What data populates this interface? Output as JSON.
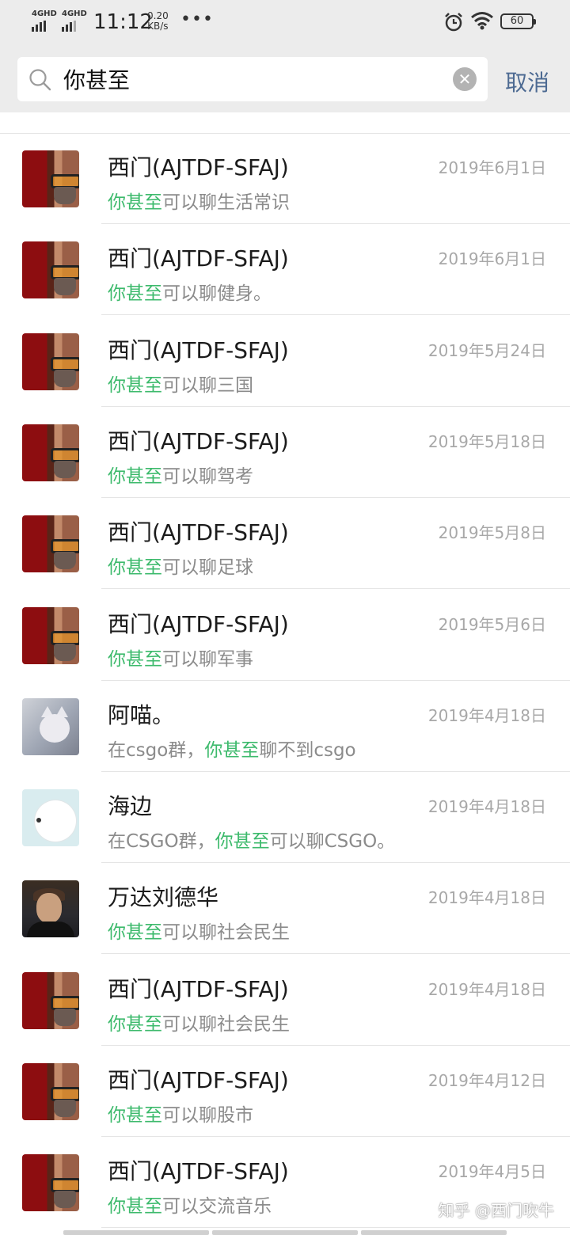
{
  "status_bar": {
    "signal1": "4GHD",
    "signal2": "4GHD",
    "time": "11:12",
    "speed_value": "0.20",
    "speed_unit": "KB/s",
    "more": "•••",
    "battery": "60"
  },
  "search": {
    "query": "你甚至",
    "cancel_label": "取消",
    "clear_icon": "clear-icon",
    "search_icon": "search-icon"
  },
  "highlight_color": "#3dba6c",
  "results": [
    {
      "name": "西门(AJTDF-SFAJ)",
      "date": "2019年6月1日",
      "pre": "",
      "hit": "你甚至",
      "post": "可以聊生活常识",
      "avatar": "ximen"
    },
    {
      "name": "西门(AJTDF-SFAJ)",
      "date": "2019年6月1日",
      "pre": "",
      "hit": "你甚至",
      "post": "可以聊健身。",
      "avatar": "ximen"
    },
    {
      "name": "西门(AJTDF-SFAJ)",
      "date": "2019年5月24日",
      "pre": "",
      "hit": "你甚至",
      "post": "可以聊三国",
      "avatar": "ximen"
    },
    {
      "name": "西门(AJTDF-SFAJ)",
      "date": "2019年5月18日",
      "pre": "",
      "hit": "你甚至",
      "post": "可以聊驾考",
      "avatar": "ximen"
    },
    {
      "name": "西门(AJTDF-SFAJ)",
      "date": "2019年5月8日",
      "pre": "",
      "hit": "你甚至",
      "post": "可以聊足球",
      "avatar": "ximen"
    },
    {
      "name": "西门(AJTDF-SFAJ)",
      "date": "2019年5月6日",
      "pre": "",
      "hit": "你甚至",
      "post": "可以聊军事",
      "avatar": "ximen"
    },
    {
      "name": "阿喵。",
      "date": "2019年4月18日",
      "pre": "在csgo群，",
      "hit": "你甚至",
      "post": "聊不到csgo",
      "avatar": "cat"
    },
    {
      "name": "海边",
      "date": "2019年4月18日",
      "pre": "在CSGO群，",
      "hit": "你甚至",
      "post": "可以聊CSGO。",
      "avatar": "bear"
    },
    {
      "name": "万达刘德华",
      "date": "2019年4月18日",
      "pre": "",
      "hit": "你甚至",
      "post": "可以聊社会民生",
      "avatar": "wanda"
    },
    {
      "name": "西门(AJTDF-SFAJ)",
      "date": "2019年4月18日",
      "pre": "",
      "hit": "你甚至",
      "post": "可以聊社会民生",
      "avatar": "ximen"
    },
    {
      "name": "西门(AJTDF-SFAJ)",
      "date": "2019年4月12日",
      "pre": "",
      "hit": "你甚至",
      "post": "可以聊股市",
      "avatar": "ximen"
    },
    {
      "name": "西门(AJTDF-SFAJ)",
      "date": "2019年4月5日",
      "pre": "",
      "hit": "你甚至",
      "post": "可以交流音乐",
      "avatar": "ximen"
    }
  ],
  "watermark": "知乎 @西门吹牛"
}
